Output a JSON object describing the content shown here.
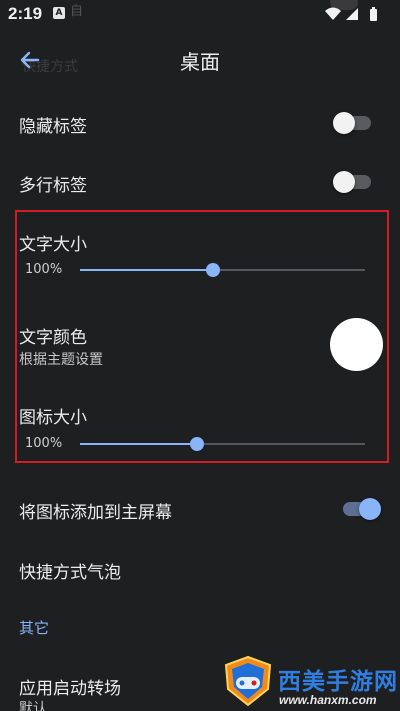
{
  "status_bar": {
    "time": "2:19",
    "notification_badge": "A",
    "ghost_text": "自",
    "icons": [
      "wifi-icon",
      "signal-icon",
      "battery-icon"
    ]
  },
  "header": {
    "title": "桌面",
    "ghost_text": "快捷方式"
  },
  "settings": {
    "hide_labels": {
      "label": "隐藏标签",
      "enabled": false
    },
    "multiline_labels": {
      "label": "多行标签",
      "enabled": false
    },
    "text_size": {
      "label": "文字大小",
      "value_text": "100%",
      "level": 0.465
    },
    "text_color": {
      "label": "文字颜色",
      "subtitle": "根据主题设置",
      "swatch_color": "#ffffff"
    },
    "icon_size": {
      "label": "图标大小",
      "value_text": "100%",
      "level": 0.41
    },
    "add_icon_home": {
      "label": "将图标添加到主屏幕",
      "enabled": true
    },
    "shortcut_bubble": {
      "label": "快捷方式气泡"
    },
    "section_other": "其它",
    "app_launch_transition": {
      "label": "应用启动转场",
      "subtitle": "默认"
    }
  },
  "watermark": {
    "title": "西美手游网",
    "url": "www.hanxm.com"
  },
  "colors": {
    "background": "#1e1f21",
    "accent": "#8ab4f8",
    "highlight_border": "#d31d24",
    "watermark_blue": "#2f7ee0"
  }
}
